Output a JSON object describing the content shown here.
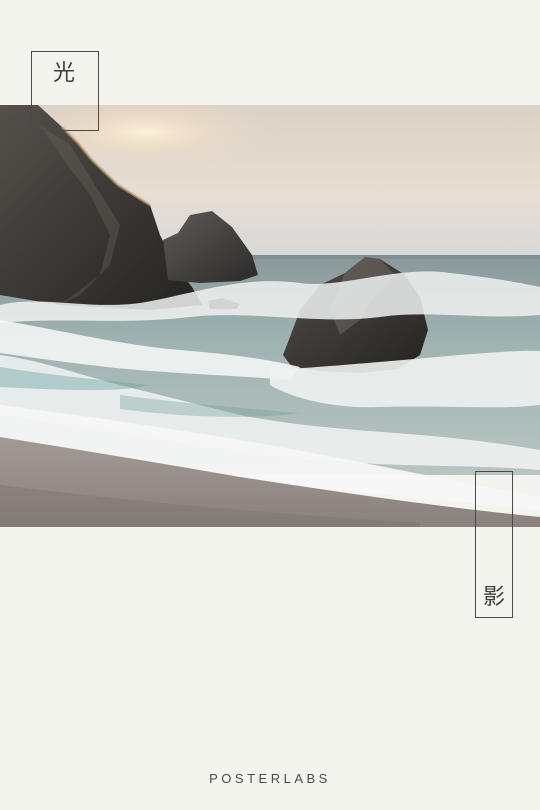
{
  "poster": {
    "top_character": "光",
    "bottom_character": "影",
    "brand": "POSTERLABS"
  },
  "colors": {
    "background": "#f4f4ef",
    "frame_line": "#4a4a4a",
    "text": "#3f3f3f"
  }
}
